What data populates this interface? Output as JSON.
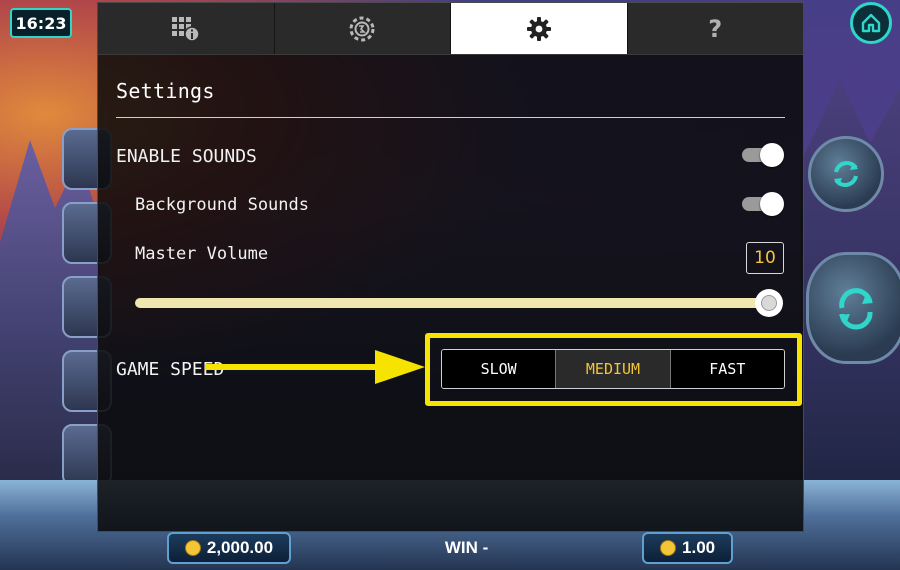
{
  "status": {
    "clock": "16:23"
  },
  "game": {
    "balance_value": "2,000.00",
    "win_label": "WIN",
    "win_value": "-",
    "bet_value": "1.00"
  },
  "tabs": [
    {
      "id": "paytable",
      "icon": "paytable-info-icon"
    },
    {
      "id": "bet",
      "icon": "chip-icon"
    },
    {
      "id": "settings",
      "icon": "gear-icon",
      "active": true
    },
    {
      "id": "help",
      "icon": "question-mark-icon",
      "text": "?"
    }
  ],
  "settings": {
    "title": "Settings",
    "enable_sounds_label": "ENABLE SOUNDS",
    "enable_sounds_on": true,
    "background_sounds_label": "Background Sounds",
    "background_sounds_on": true,
    "master_volume_label": "Master Volume",
    "master_volume_value": "10",
    "master_volume_fraction": 1.0,
    "game_speed_label": "GAME SPEED",
    "speed_options": [
      "SLOW",
      "MEDIUM",
      "FAST"
    ],
    "speed_selected": "MEDIUM"
  },
  "colors": {
    "accent_yellow": "#f6e400",
    "selected_text": "#f3c537",
    "teal": "#2fd6c9"
  }
}
